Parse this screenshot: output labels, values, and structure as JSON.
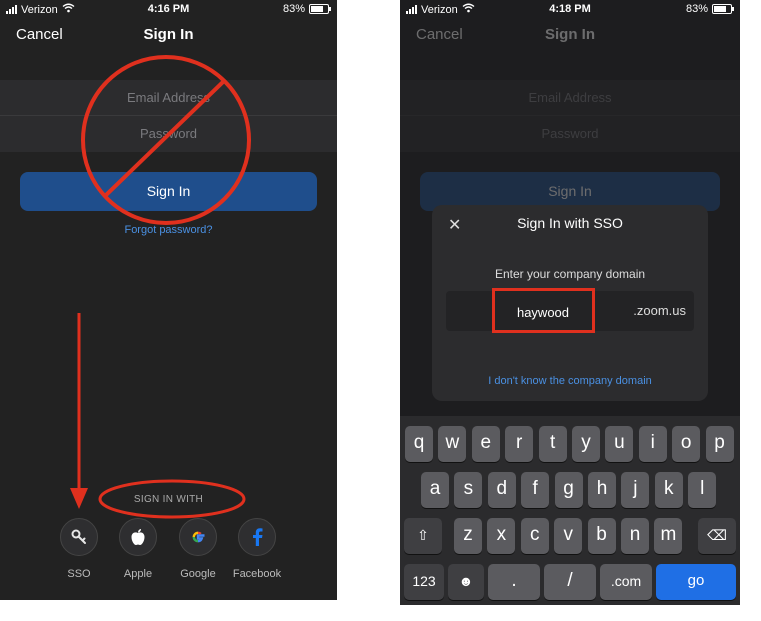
{
  "left": {
    "status": {
      "carrier": "Verizon",
      "time": "4:16 PM",
      "battery": "83%"
    },
    "nav": {
      "cancel": "Cancel",
      "title": "Sign In"
    },
    "email_placeholder": "Email Address",
    "password_placeholder": "Password",
    "signin_button": "Sign In",
    "forgot": "Forgot password?",
    "signin_with": "SIGN IN WITH",
    "providers": [
      {
        "label": "SSO",
        "icon": "key-icon"
      },
      {
        "label": "Apple",
        "icon": "apple-icon"
      },
      {
        "label": "Google",
        "icon": "google-icon"
      },
      {
        "label": "Facebook",
        "icon": "facebook-icon"
      }
    ]
  },
  "right": {
    "status": {
      "carrier": "Verizon",
      "time": "4:18 PM",
      "battery": "83%"
    },
    "nav": {
      "cancel": "Cancel",
      "title": "Sign In"
    },
    "email_placeholder": "Email Address",
    "password_placeholder": "Password",
    "signin_button": "Sign In",
    "modal": {
      "close": "✕",
      "title": "Sign In with SSO",
      "prompt": "Enter your company domain",
      "domain_value": "haywood",
      "suffix": ".zoom.us",
      "dont_know": "I don't know the company domain"
    },
    "keyboard": {
      "row1": [
        "q",
        "w",
        "e",
        "r",
        "t",
        "y",
        "u",
        "i",
        "o",
        "p"
      ],
      "row2": [
        "a",
        "s",
        "d",
        "f",
        "g",
        "h",
        "j",
        "k",
        "l"
      ],
      "row3": [
        "z",
        "x",
        "c",
        "v",
        "b",
        "n",
        "m"
      ],
      "shift": "⇧",
      "backspace": "⌫",
      "num": "123",
      "emoji": "☻",
      "dot": ".",
      "slash": "/",
      "dotcom": ".com",
      "go": "go"
    }
  },
  "colors": {
    "annotation": "#e0301e",
    "link": "#4a90e2",
    "signin": "#1f4e8c",
    "go": "#1f6fe5"
  }
}
